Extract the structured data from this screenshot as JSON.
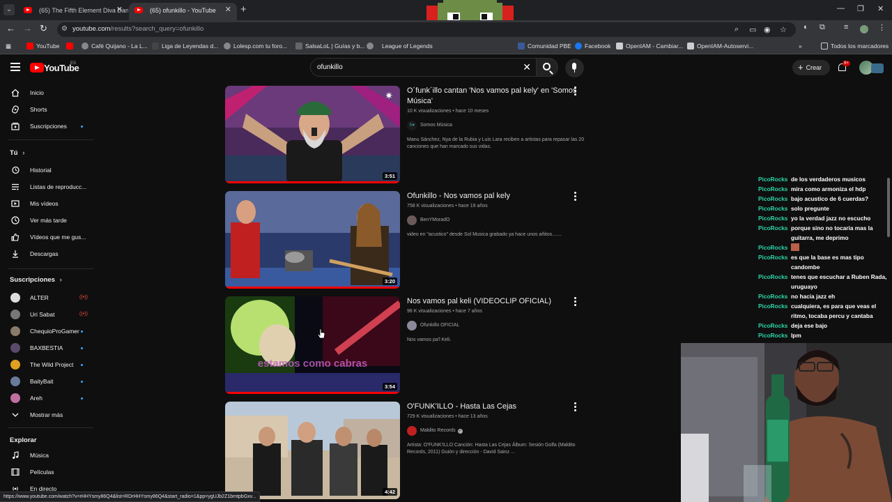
{
  "browser": {
    "tabs": [
      {
        "title": "(65) The Fifth Element Diva Dan",
        "active": false
      },
      {
        "title": "(65) ofunkillo - YouTube",
        "active": true
      }
    ],
    "url_host": "youtube.com",
    "url_path": "/results?search_query=ofunkillo",
    "bookmarks": [
      {
        "label": "YouTube",
        "color": "#ff0000"
      },
      {
        "label": "",
        "color": "#ff0000"
      },
      {
        "label": "Café Quijano - La L...",
        "color": "#888888"
      },
      {
        "label": "Liga de Leyendas d...",
        "color": "#444444"
      },
      {
        "label": "Lolesp.com tu foro...",
        "color": "#888888"
      },
      {
        "label": "SalsaLoL | Guías y b...",
        "color": "#666666"
      },
      {
        "label": "League of Legends",
        "color": "#888888"
      },
      {
        "label": "Comunidad PBE",
        "color": "#3b5a9a"
      },
      {
        "label": "Facebook",
        "color": "#1877f2"
      },
      {
        "label": "OpenIAM - Cambiar...",
        "color": "#cccccc"
      },
      {
        "label": "OpenIAM-Autoservi...",
        "color": "#cccccc"
      }
    ],
    "bookmarks_folder": "Todos los marcadores",
    "status_url": "https://www.youtube.com/watch?v=rHHYsmy86Q4&list=RDrHHYsmy86Q4&start_radio=1&pp=ygUJb2Z1bmtpbGxv..."
  },
  "header": {
    "logo": "YouTube",
    "country": "ES",
    "search_query": "ofunkillo",
    "create_label": "Crear",
    "notifications": "9+"
  },
  "sidebar": {
    "main": [
      {
        "label": "Inicio",
        "icon": "home-icon"
      },
      {
        "label": "Shorts",
        "icon": "shorts-icon"
      },
      {
        "label": "Suscripciones",
        "icon": "subscriptions-icon"
      }
    ],
    "you_heading": "Tú",
    "you": [
      {
        "label": "Historial",
        "icon": "history-icon"
      },
      {
        "label": "Listas de reproducc...",
        "icon": "playlists-icon"
      },
      {
        "label": "Mis vídeos",
        "icon": "my-videos-icon"
      },
      {
        "label": "Ver más tarde",
        "icon": "watch-later-icon"
      },
      {
        "label": "Vídeos que me gus...",
        "icon": "liked-icon"
      },
      {
        "label": "Descargas",
        "icon": "download-icon"
      }
    ],
    "subs_heading": "Suscripciones",
    "subs": [
      {
        "label": "ALTER",
        "status": "live",
        "color": "#dddddd"
      },
      {
        "label": "Uri Sabat",
        "status": "live",
        "color": "#777777"
      },
      {
        "label": "ChequioProGamer",
        "status": "new",
        "color": "#8a7a6a"
      },
      {
        "label": "BAXBESTIA",
        "status": "new",
        "color": "#5a4a6a"
      },
      {
        "label": "The Wild Project",
        "status": "new",
        "color": "#e0a020"
      },
      {
        "label": "BaityBait",
        "status": "new",
        "color": "#6a7a9a"
      },
      {
        "label": "Areh",
        "status": "new",
        "color": "#c070a0"
      }
    ],
    "show_more": "Mostrar más",
    "explore_heading": "Explorar",
    "explore": [
      {
        "label": "Música",
        "icon": "music-icon"
      },
      {
        "label": "Películas",
        "icon": "movies-icon"
      },
      {
        "label": "En directo",
        "icon": "live-icon"
      }
    ]
  },
  "results": [
    {
      "title": "O´funk´illo cantan 'Nos vamos pal kely' en 'Somos Música'",
      "meta": "10 K visualizaciones • hace 10 meses",
      "channel": "Somos Música",
      "verified": false,
      "description": "Manu Sánchez, Nya de la Rubia y Luis Lara reciben a artistas para repasar las 20 canciones que han marcado sus vidas.",
      "duration": "3:51",
      "watched": 1.0
    },
    {
      "title": "Ofunkillo - Nos vamos pal kely",
      "meta": "758 K visualizaciones • hace 19 años",
      "channel": "BenYMoradO",
      "verified": false,
      "description": "video en \"acustico\" desde Sol Musica grabado ya hace unos añitos.......",
      "duration": "3:20",
      "watched": 1.0
    },
    {
      "title": "Nos vamos pal keli (VIDEOCLIP OFICIAL)",
      "meta": "96 K visualizaciones • hace 7 años",
      "channel": "Ofunkillo OFICIAL",
      "verified": false,
      "description": "Nos vamos pa'l Keli.",
      "duration": "3:54",
      "watched": 1.0,
      "overlay_text": "estamos como cabras"
    },
    {
      "title": "O'FUNK'ILLO - Hasta Las Cejas",
      "meta": "729 K visualizaciones • hace 13 años",
      "channel": "Maldito Records",
      "verified": true,
      "description": "Artista: O'FUNK'ILLO Canción: Hasta Las Cejas Álbum: Sesión Golfa (Maldito Records, 2011) Guión y dirección - David Sainz ...",
      "duration": "4:42",
      "watched": 0
    }
  ],
  "chat": [
    {
      "user": "PicoRocks",
      "msg": "de los verdaderos musicos"
    },
    {
      "user": "PicoRocks",
      "msg": "mira como armoniza el hdp"
    },
    {
      "user": "PicoRocks",
      "msg": "bajo acustico de 6 cuerdas?"
    },
    {
      "user": "PicoRocks",
      "msg": "solo pregunte"
    },
    {
      "user": "PicoRocks",
      "msg": "yo la verdad jazz no escucho"
    },
    {
      "user": "PicoRocks",
      "msg": "porque sino no tocaria mas la guitarra, me deprimo"
    },
    {
      "user": "PicoRocks",
      "msg": "",
      "emote": true
    },
    {
      "user": "PicoRocks",
      "msg": "es que la base es mas tipo candombe"
    },
    {
      "user": "PicoRocks",
      "msg": "tenes que escuchar a Ruben Rada, uruguayo"
    },
    {
      "user": "PicoRocks",
      "msg": "no hacia jazz eh"
    },
    {
      "user": "PicoRocks",
      "msg": "cualquiera, es para que veas el ritmo, tocaba percu y cantaba"
    },
    {
      "user": "PicoRocks",
      "msg": "deja ese bajo"
    },
    {
      "user": "PicoRocks",
      "msg": "lpm"
    }
  ]
}
